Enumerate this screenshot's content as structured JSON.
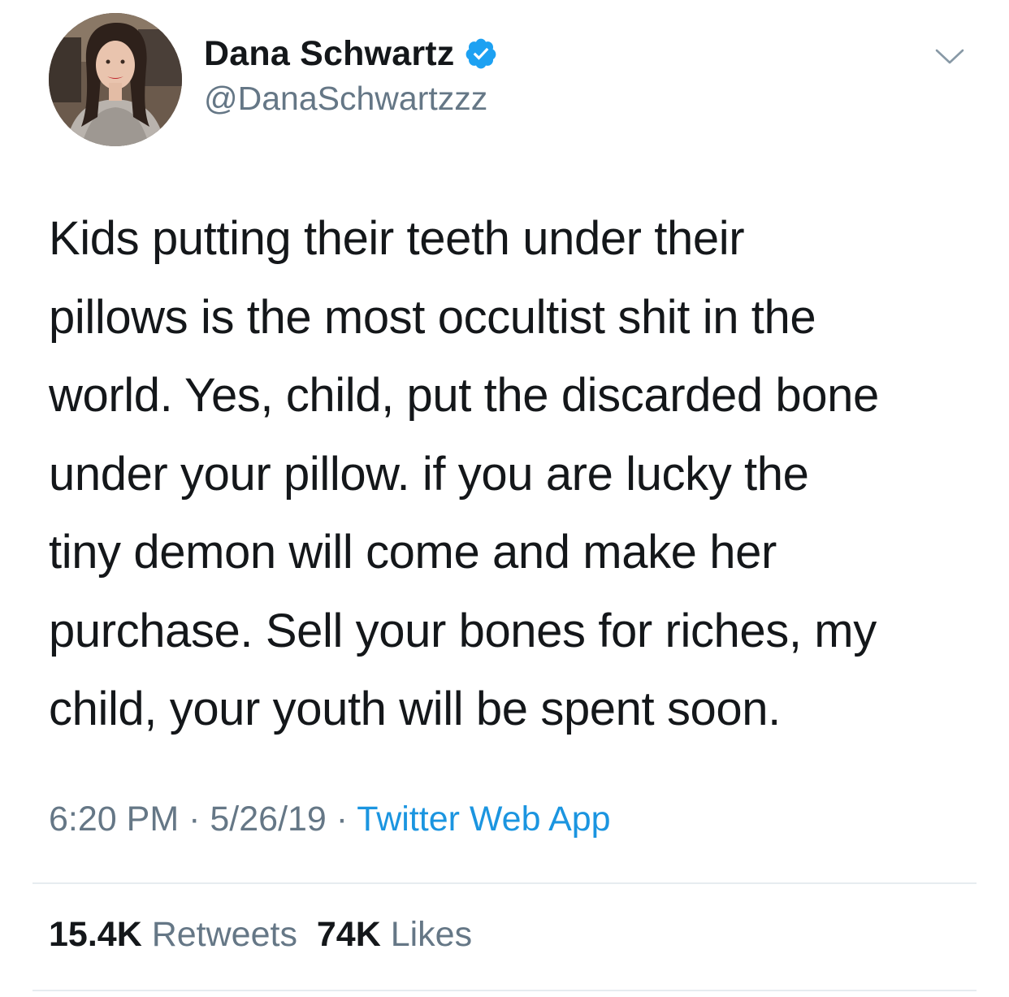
{
  "author": {
    "display_name": "Dana Schwartz",
    "handle": "@DanaSchwartzzz",
    "verified": true,
    "verified_color": "#1da1f2"
  },
  "tweet": {
    "text": "Kids putting their teeth under their\npillows is the most occultist shit in the\nworld. Yes, child, put the discarded bone\nunder your pillow. if you are lucky the\ntiny demon will come and make her\npurchase. Sell your bones for riches, my\nchild, your youth will be spent soon."
  },
  "meta": {
    "time": "6:20 PM",
    "date": "5/26/19",
    "separator": "·",
    "source": "Twitter Web App"
  },
  "stats": {
    "retweets_count": "15.4K",
    "retweets_label": "Retweets",
    "likes_count": "74K",
    "likes_label": "Likes"
  },
  "colors": {
    "text": "#14171a",
    "secondary": "#657786",
    "link": "#1b95e0",
    "divider": "#e6ecf0"
  },
  "icons": {
    "verified": "verified-badge-icon",
    "more": "chevron-down-icon"
  }
}
